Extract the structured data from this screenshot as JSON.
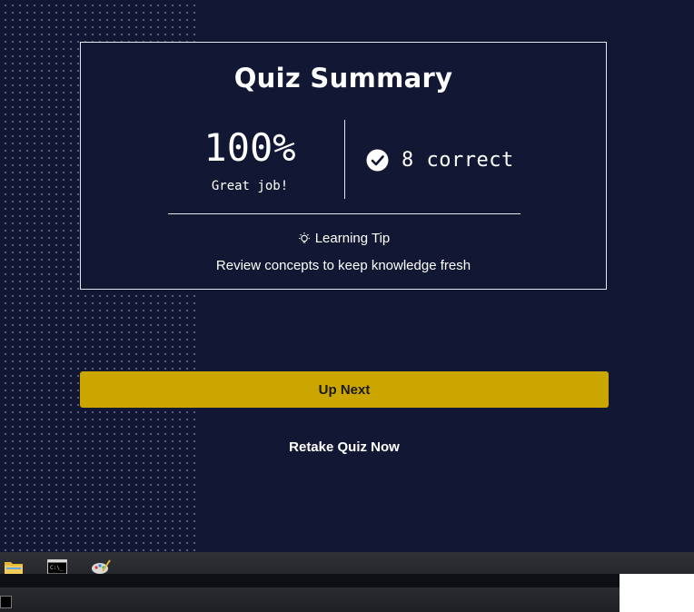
{
  "summary": {
    "title": "Quiz Summary",
    "score": "100%",
    "score_message": "Great job!",
    "correct_text": "8 correct",
    "tip_heading": "Learning Tip",
    "tip_body": "Review concepts to keep knowledge fresh"
  },
  "actions": {
    "next_label": "Up Next",
    "retake_label": "Retake Quiz Now"
  },
  "colors": {
    "background": "#121833",
    "accent": "#cca600",
    "text": "#ffffff"
  },
  "taskbar": {
    "icons": [
      "folder-icon",
      "terminal-icon",
      "paint-icon"
    ]
  }
}
